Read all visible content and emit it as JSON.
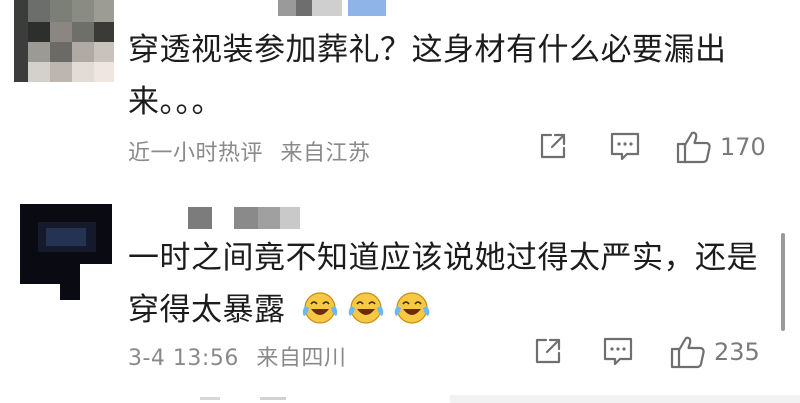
{
  "comments": [
    {
      "text_line1": "穿透视装参加葬礼？这身材有什么必要漏出",
      "text_line2": "来。。。",
      "time": "近一小时热评",
      "location": "来自江苏",
      "likes": "170"
    },
    {
      "text_line1": "一时之间竟不知道应该说她过得太严实，还是",
      "text_line2": "穿得太暴露",
      "emojis": [
        "laugh-cry-emoji",
        "laugh-cry-emoji",
        "laugh-cry-emoji"
      ],
      "time": "3-4 13:56",
      "location": "来自四川",
      "likes": "235"
    }
  ],
  "icons": {
    "share": "share-icon",
    "comment": "comment-icon",
    "like": "thumbs-up-icon"
  }
}
